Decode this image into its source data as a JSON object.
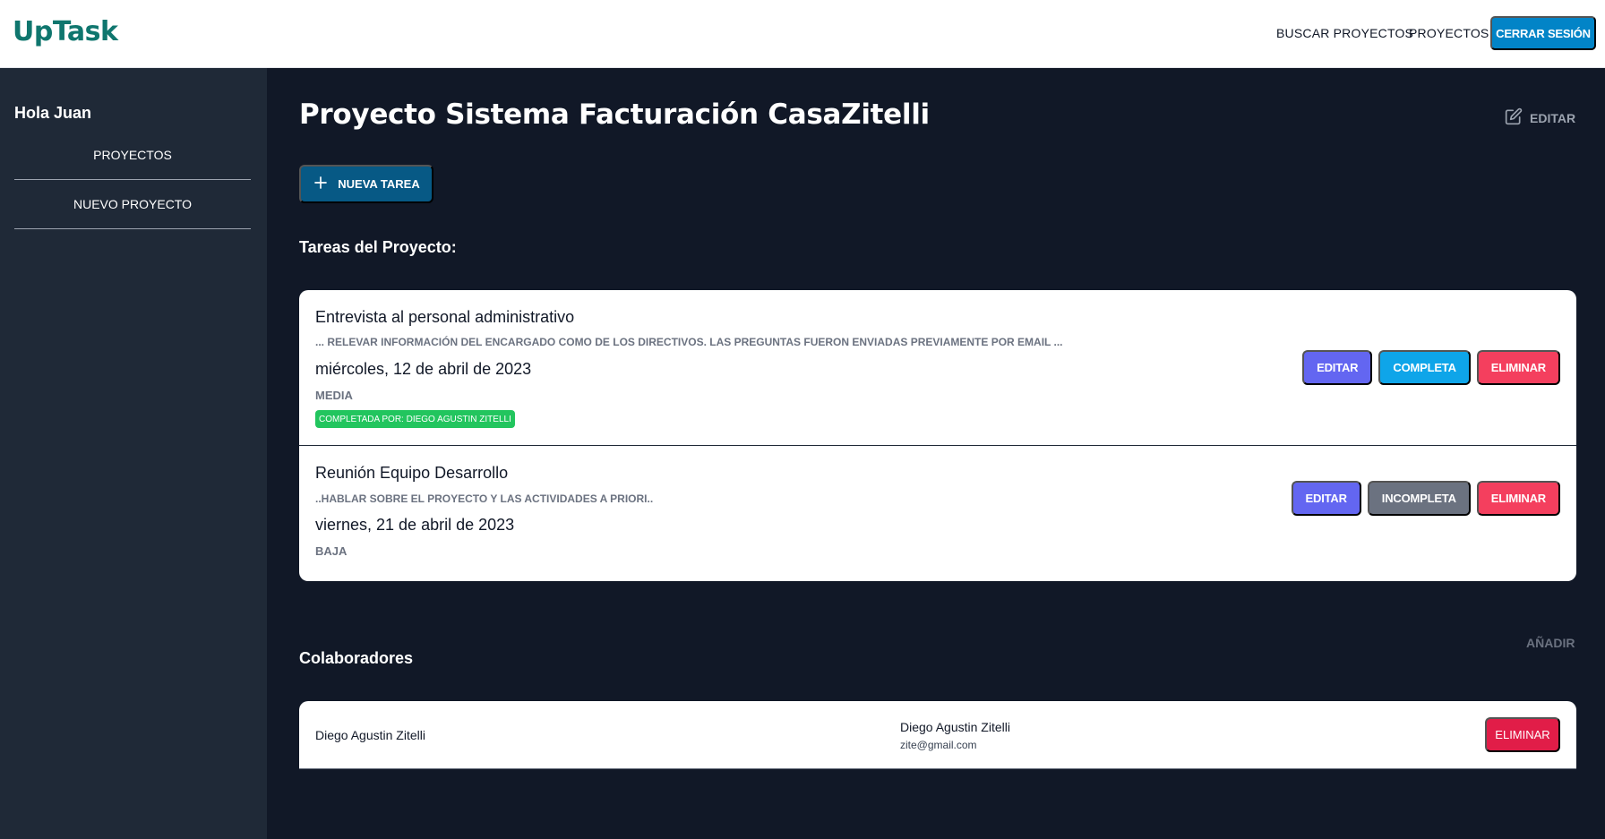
{
  "header": {
    "logo": "UpTask",
    "nav": {
      "search_projects": "BUSCAR PROYECTOS",
      "projects": "PROYECTOS",
      "logout": "CERRAR SESIÓN"
    }
  },
  "sidebar": {
    "greeting": "Hola Juan",
    "items": [
      {
        "label": "PROYECTOS"
      },
      {
        "label": "NUEVO PROYECTO"
      }
    ]
  },
  "main": {
    "title": "Proyecto Sistema Facturación CasaZitelli",
    "edit_label": "EDITAR",
    "new_task_label": "NUEVA TAREA",
    "tasks_heading": "Tareas del Proyecto:",
    "tasks": [
      {
        "name": "Entrevista al personal administrativo",
        "description": "... RELEVAR INFORMACIÓN DEL ENCARGADO COMO DE LOS DIRECTIVOS. LAS PREGUNTAS FUERON ENVIADAS PREVIAMENTE POR EMAIL ...",
        "date": "miércoles, 12 de abril de 2023",
        "priority": "MEDIA",
        "completed_by": "COMPLETADA POR: DIEGO AGUSTIN ZITELLI",
        "actions": {
          "edit": "EDITAR",
          "toggle": "COMPLETA",
          "delete": "ELIMINAR"
        }
      },
      {
        "name": "Reunión Equipo Desarrollo",
        "description": "..HABLAR SOBRE EL PROYECTO Y LAS ACTIVIDADES A PRIORI..",
        "date": "viernes, 21 de abril de 2023",
        "priority": "BAJA",
        "actions": {
          "edit": "EDITAR",
          "toggle": "INCOMPLETA",
          "delete": "ELIMINAR"
        }
      }
    ],
    "collaborators_heading": "Colaboradores",
    "add_collaborator_label": "AÑADIR",
    "collaborators": [
      {
        "name_left": "Diego Agustin Zitelli",
        "name": "Diego Agustin Zitelli",
        "email": "zite@gmail.com",
        "delete_label": "ELIMINAR"
      }
    ]
  },
  "colors": {
    "brand": "#0f766e",
    "background": "#111827",
    "sidebar": "#1f2937",
    "logout_button": "#0284c7",
    "new_task_button": "#075985",
    "edit_button": "#6366f1",
    "complete_button": "#0ea5e9",
    "incomplete_button": "#6b7280",
    "delete_button": "#f43f5e",
    "completed_badge": "#22c55e"
  }
}
